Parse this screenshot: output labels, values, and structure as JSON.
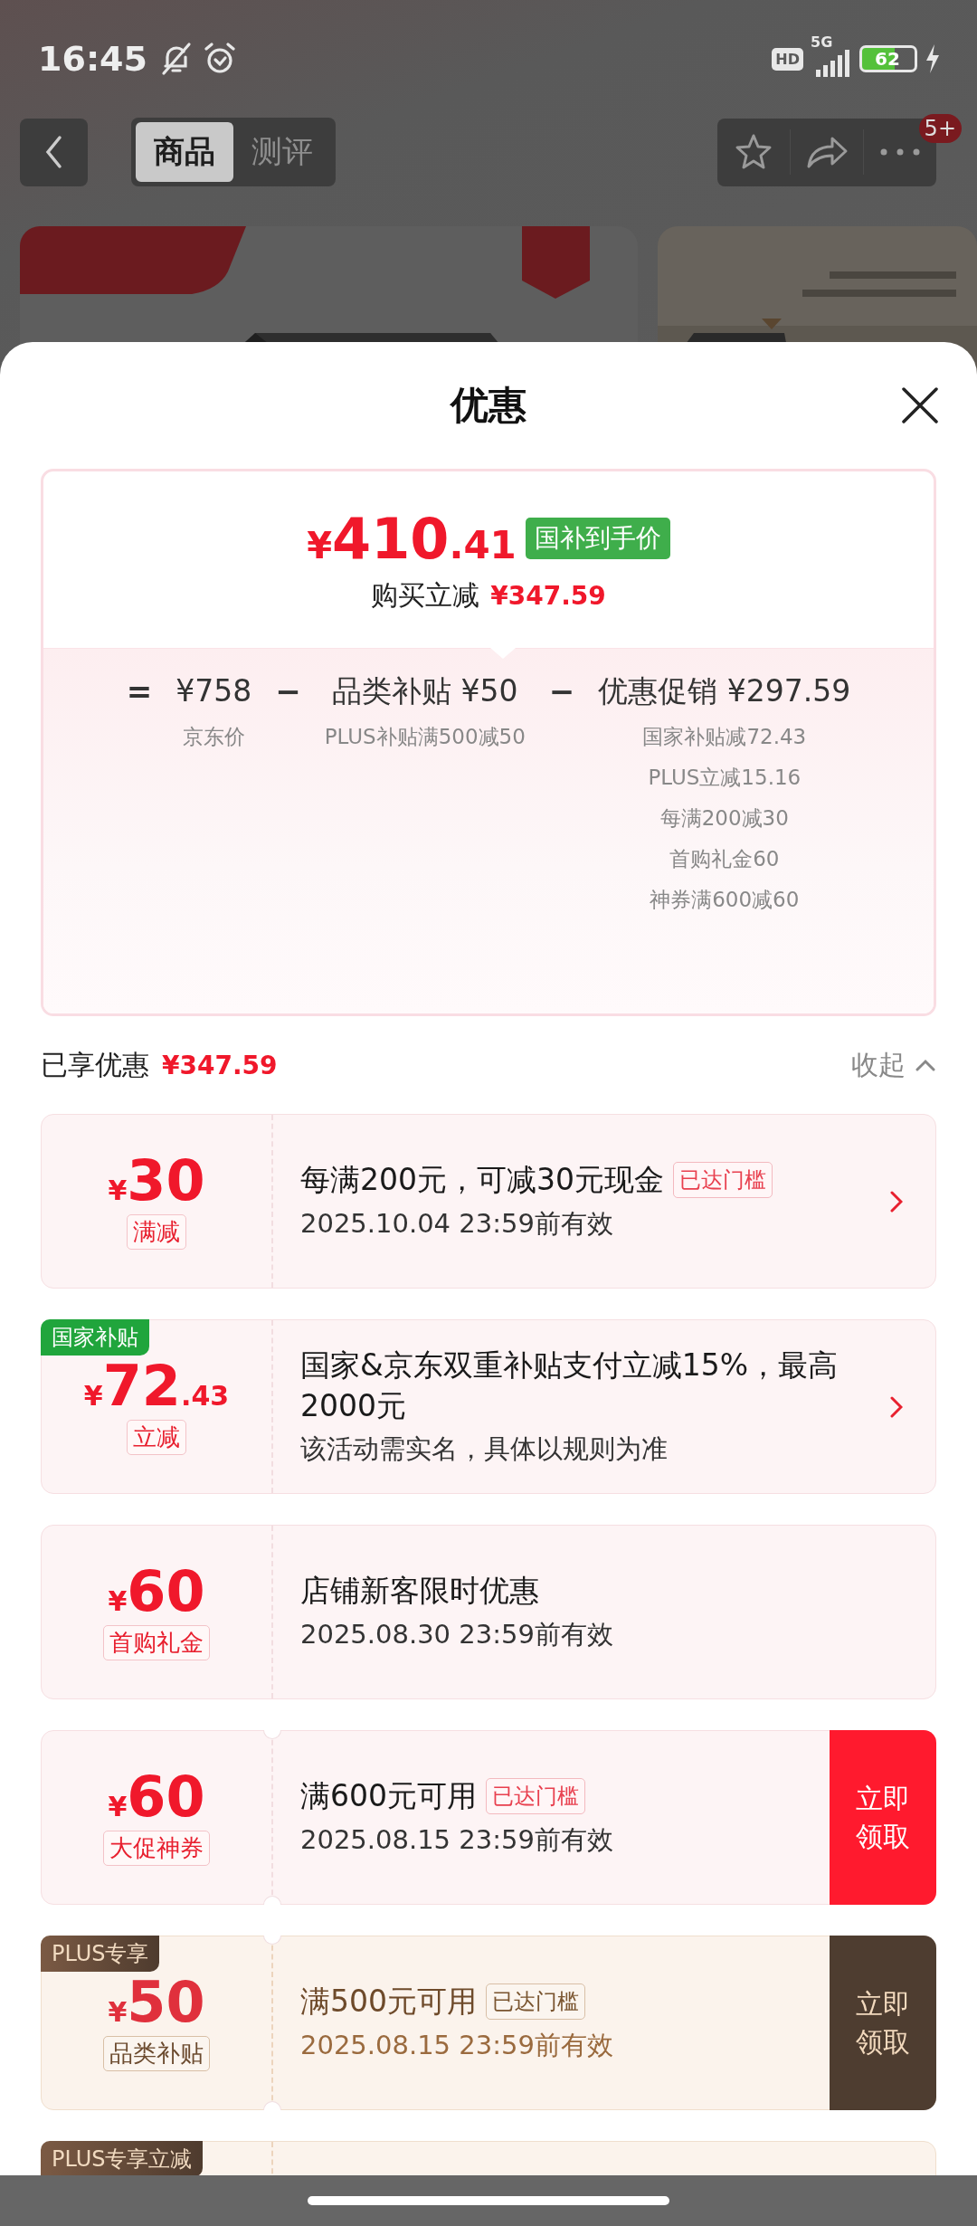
{
  "status_bar": {
    "time": "16:45",
    "hd": "HD",
    "network": "5G",
    "battery": "62"
  },
  "nav": {
    "tabs": [
      {
        "label": "商品",
        "selected": true
      },
      {
        "label": "测评",
        "selected": false
      }
    ],
    "badge": "5+"
  },
  "sheet": {
    "title": "优惠",
    "price": {
      "currency": "¥",
      "amount": "410.41",
      "tag": "国补到手价",
      "saving_label": "购买立减",
      "saving": "¥347.59"
    },
    "breakdown": [
      {
        "kind": "op",
        "text": "="
      },
      {
        "kind": "term",
        "text": "¥758",
        "notes": [
          "京东价"
        ]
      },
      {
        "kind": "op",
        "text": "−"
      },
      {
        "kind": "term",
        "text": "品类补贴 ¥50",
        "notes": [
          "PLUS补贴满500减50"
        ]
      },
      {
        "kind": "op",
        "text": "−"
      },
      {
        "kind": "term",
        "text": "优惠促销 ¥297.59",
        "notes": [
          "国家补贴减72.43",
          "PLUS立减15.16",
          "每满200减30",
          "首购礼金60",
          "神券满600减60"
        ]
      }
    ],
    "summary": {
      "label": "已享优惠",
      "amount": "¥347.59",
      "toggle": "收起",
      "expanded": true
    },
    "coupons": [
      {
        "kind": "red",
        "notched": false,
        "currency": "¥",
        "amount": "30",
        "type_label": "满减",
        "title": "每满200元，可减30元现金",
        "badge": "已达门槛",
        "lines": [
          "2025.10.04 23:59前有效"
        ],
        "action": {
          "kind": "chevron"
        }
      },
      {
        "kind": "red",
        "notched": false,
        "tag": {
          "kind": "green",
          "text": "国家补贴"
        },
        "currency": "¥",
        "amount": "72.43",
        "type_label": "立减",
        "title": "国家&京东双重补贴支付立减15%，最高2000元",
        "lines": [
          "该活动需实名，具体以规则为准"
        ],
        "action": {
          "kind": "chevron"
        }
      },
      {
        "kind": "red",
        "notched": false,
        "currency": "¥",
        "amount": "60",
        "type_label": "首购礼金",
        "title": "店铺新客限时优惠",
        "lines": [
          "2025.08.30 23:59前有效"
        ]
      },
      {
        "kind": "red",
        "notched": true,
        "currency": "¥",
        "amount": "60",
        "type_label": "大促神券",
        "title": "满600元可用",
        "badge": "已达门槛",
        "lines": [
          "2025.08.15 23:59前有效"
        ],
        "action": {
          "kind": "button",
          "text": "立即领取"
        }
      },
      {
        "kind": "plus",
        "notched": true,
        "tag": {
          "kind": "plus",
          "text": "PLUS专享"
        },
        "currency": "¥",
        "amount": "50",
        "type_label": "品类补贴",
        "title": "满500元可用",
        "badge": "已达门槛",
        "lines": [
          "2025.08.15 23:59前有效"
        ],
        "action": {
          "kind": "button",
          "text": "立即领取"
        }
      },
      {
        "kind": "plus",
        "notched": false,
        "tag": {
          "kind": "plus",
          "text": "PLUS专享立减"
        }
      }
    ]
  }
}
